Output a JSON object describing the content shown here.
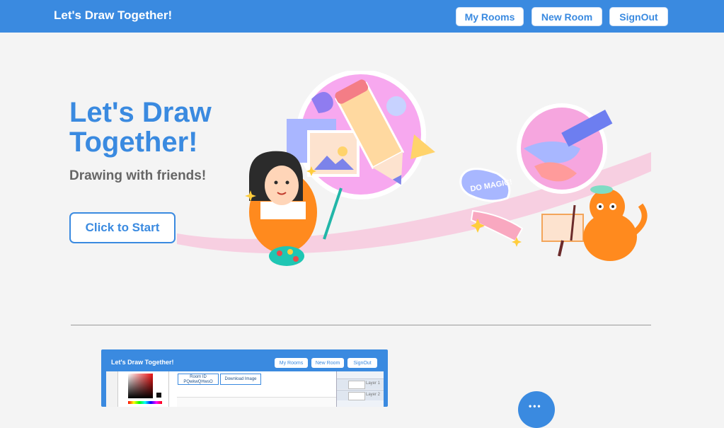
{
  "header": {
    "brand": "Let's Draw Together!",
    "nav": [
      {
        "label": "My Rooms"
      },
      {
        "label": "New Room"
      },
      {
        "label": "SignOut"
      }
    ]
  },
  "hero": {
    "title": "Let's Draw Together!",
    "subtitle": "Drawing with friends!",
    "cta_label": "Click to Start",
    "sticker_text": "DO MAGIC!"
  },
  "preview": {
    "brand": "Let's Draw Together!",
    "nav": [
      {
        "label": "My Rooms"
      },
      {
        "label": "New Room"
      },
      {
        "label": "SignOut"
      }
    ],
    "room_id_label": "Room ID",
    "room_id_value": "PQwkwQHwsO",
    "download_label": "Download Image",
    "layers": [
      {
        "name": "Layer 1"
      },
      {
        "name": "Layer 2"
      }
    ]
  },
  "colors": {
    "primary": "#3a8ae0",
    "background": "#f4f4f4",
    "subtitle": "#666666"
  }
}
